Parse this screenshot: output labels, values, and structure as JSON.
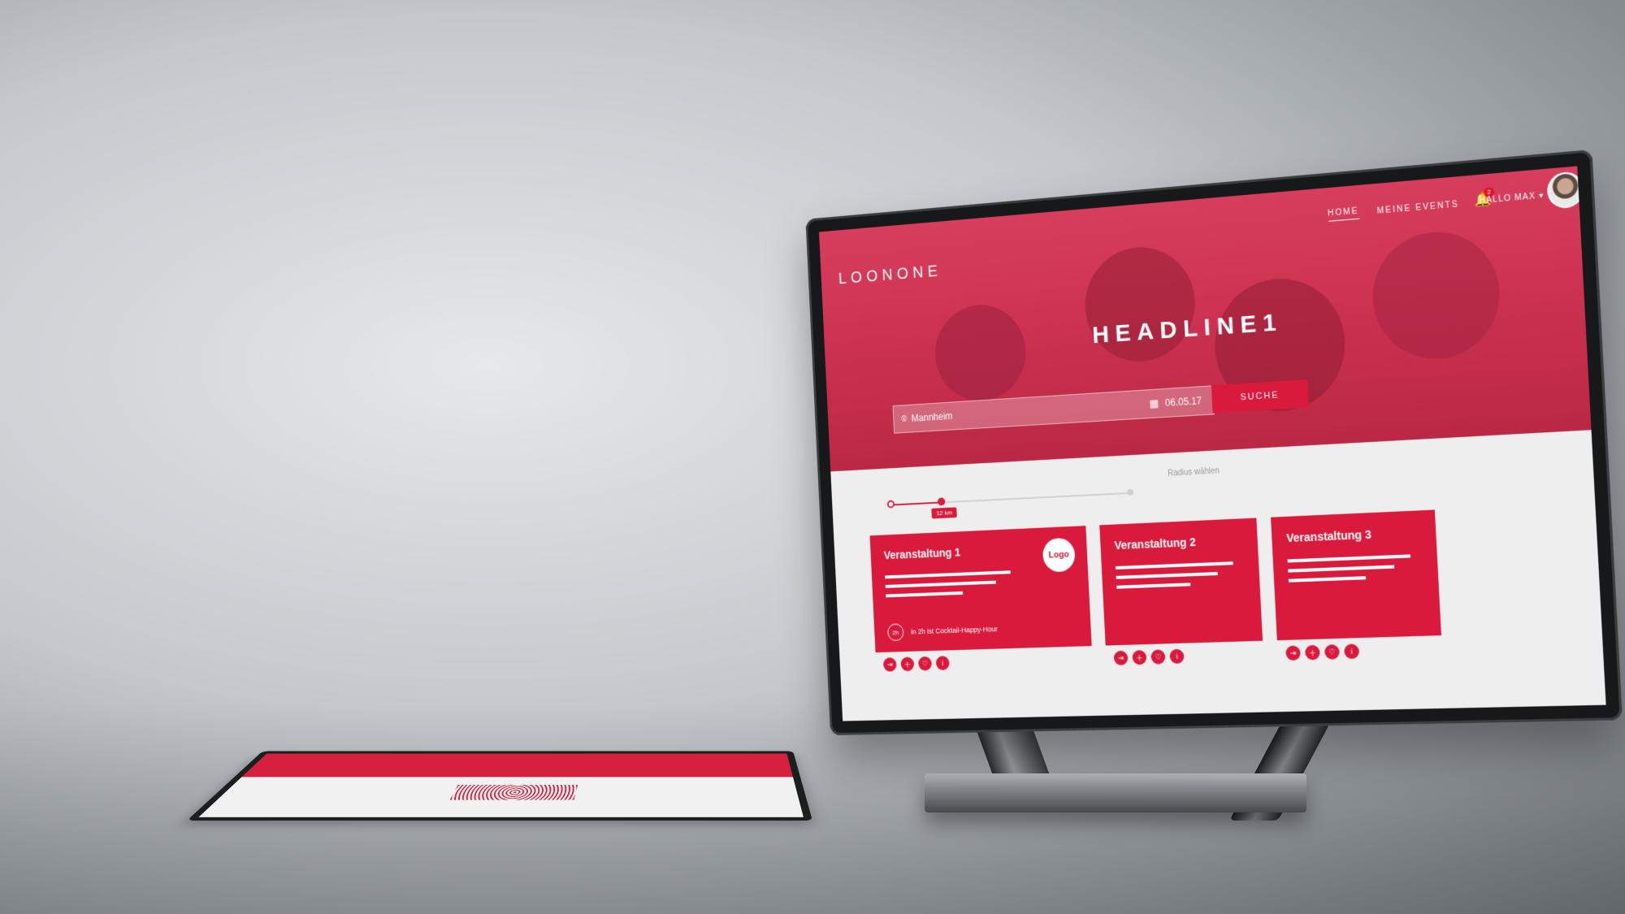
{
  "app": {
    "logo": "LOONONE"
  },
  "nav": {
    "items": [
      {
        "label": "HOME",
        "active": true
      },
      {
        "label": "MEINE EVENTS",
        "active": false
      }
    ],
    "notification_count": "2",
    "greeting": "HALLO MAX",
    "greeting_caret": "▾"
  },
  "hero": {
    "headline": "HEADLINE1",
    "search": {
      "location_value": "Mannheim",
      "date_value": "06.05.17",
      "button_label": "SUCHE"
    }
  },
  "radius": {
    "label": "Radius wählen",
    "value_label": "12 km",
    "level_fraction": 0.22
  },
  "events": [
    {
      "title": "Veranstaltung 1",
      "logo": "Logo",
      "timer": "2h",
      "note": "in 2h ist Cocktail-Happy-Hour"
    },
    {
      "title": "Veranstaltung 2"
    },
    {
      "title": "Veranstaltung 3"
    }
  ],
  "icons": {
    "location": "pin-icon",
    "calendar": "calendar-icon",
    "notification": "bell-icon",
    "actions": [
      "login-icon",
      "add-user-icon",
      "heart-icon",
      "info-icon"
    ]
  },
  "colors": {
    "accent": "#d91a3c",
    "hero_tint": "#d44a6a",
    "content_bg": "#eeeeee"
  }
}
